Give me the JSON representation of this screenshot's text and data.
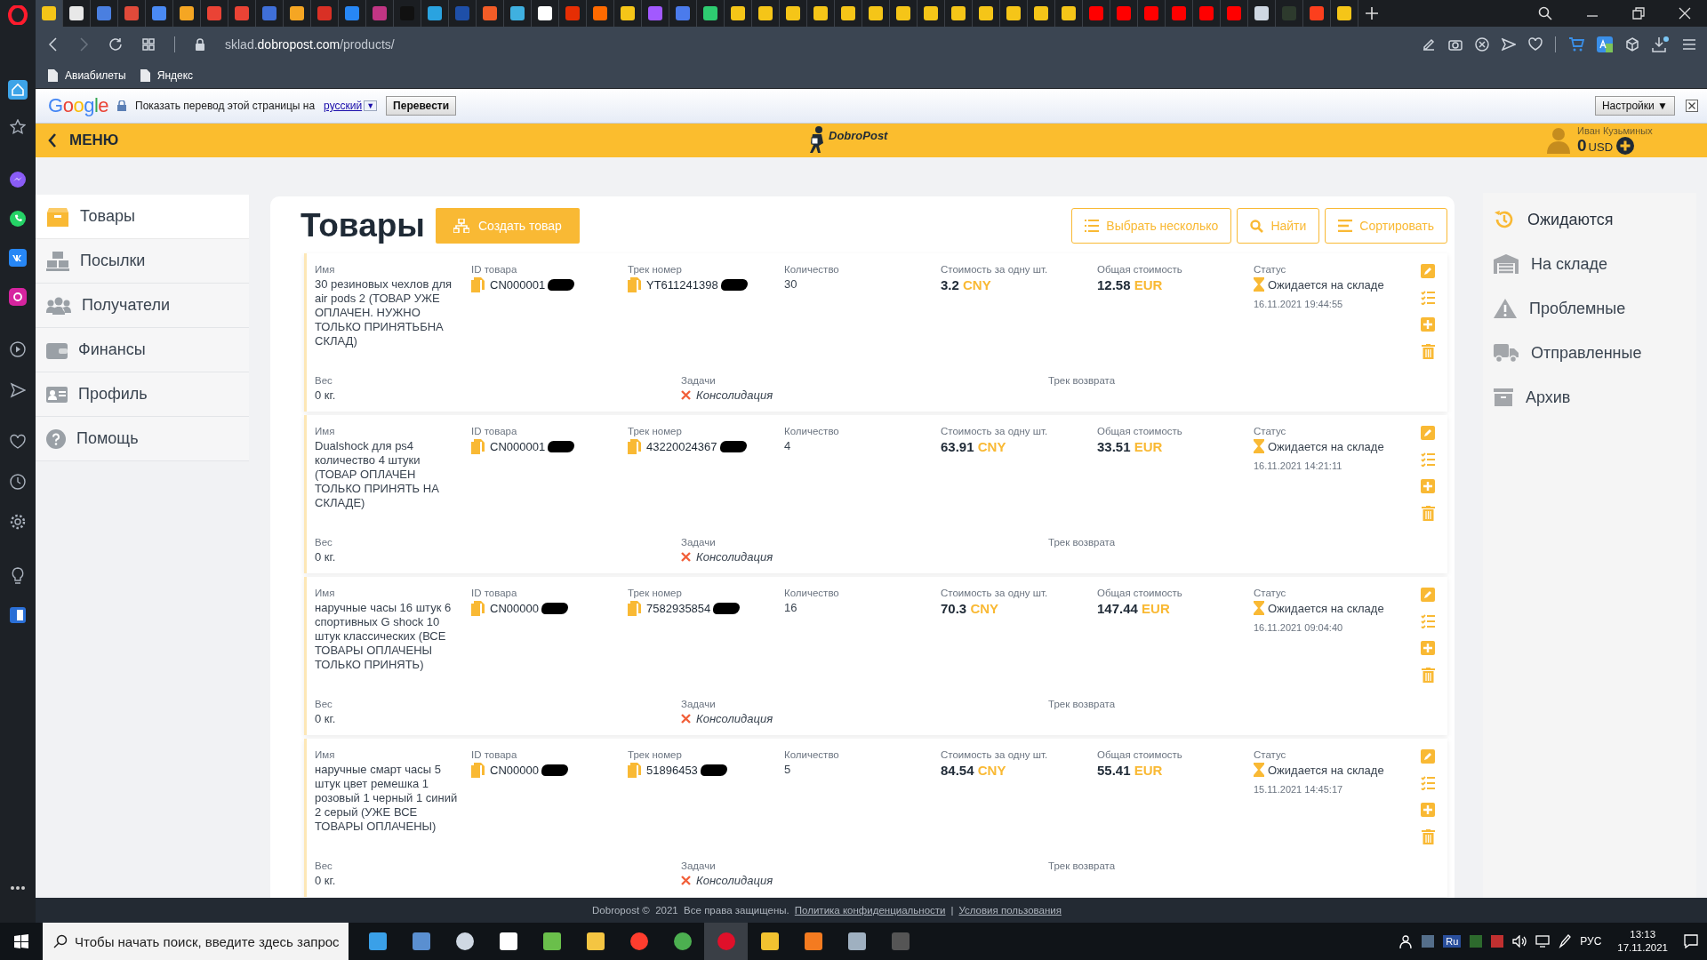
{
  "browser": {
    "tabs": [
      {
        "selected": true,
        "color": "#f5c518"
      },
      {
        "selected": false,
        "color": "#e8e8e8"
      },
      {
        "selected": false,
        "color": "#4a7fe0"
      },
      {
        "selected": false,
        "color": "#e04a3a"
      },
      {
        "selected": false,
        "color": "#4a8af4"
      },
      {
        "selected": false,
        "color": "#f5a623"
      },
      {
        "selected": false,
        "color": "#ea4335"
      },
      {
        "selected": false,
        "color": "#ea4335"
      },
      {
        "selected": false,
        "color": "#3f6fd8"
      },
      {
        "selected": false,
        "color": "#f5a623"
      },
      {
        "selected": false,
        "color": "#d93025"
      },
      {
        "selected": false,
        "color": "#2787f5"
      },
      {
        "selected": false,
        "color": "#c13584"
      },
      {
        "selected": false,
        "color": "#111111"
      },
      {
        "selected": false,
        "color": "#2aa3e0"
      },
      {
        "selected": false,
        "color": "#1e4fa8"
      },
      {
        "selected": false,
        "color": "#f25c27"
      },
      {
        "selected": false,
        "color": "#3fb0e0"
      },
      {
        "selected": false,
        "color": "#ffffff"
      },
      {
        "selected": false,
        "color": "#e62e04"
      },
      {
        "selected": false,
        "color": "#ff6a00"
      },
      {
        "selected": false,
        "color": "#f5c518"
      },
      {
        "selected": false,
        "color": "#a259ff"
      },
      {
        "selected": false,
        "color": "#4b7bec"
      },
      {
        "selected": false,
        "color": "#2ecc71"
      },
      {
        "selected": false,
        "color": "#f5c518"
      },
      {
        "selected": false,
        "color": "#f5c518"
      },
      {
        "selected": false,
        "color": "#f5c518"
      },
      {
        "selected": false,
        "color": "#f5c518"
      },
      {
        "selected": false,
        "color": "#f5c518"
      },
      {
        "selected": false,
        "color": "#f5c518"
      },
      {
        "selected": false,
        "color": "#f5c518"
      },
      {
        "selected": false,
        "color": "#f5c518"
      },
      {
        "selected": false,
        "color": "#f5c518"
      },
      {
        "selected": false,
        "color": "#f5c518"
      },
      {
        "selected": false,
        "color": "#f5c518"
      },
      {
        "selected": false,
        "color": "#f5c518"
      },
      {
        "selected": false,
        "color": "#f5c518"
      },
      {
        "selected": false,
        "color": "#ff0000"
      },
      {
        "selected": false,
        "color": "#ff0000"
      },
      {
        "selected": false,
        "color": "#ff0000"
      },
      {
        "selected": false,
        "color": "#ff0000"
      },
      {
        "selected": false,
        "color": "#ff0000"
      },
      {
        "selected": false,
        "color": "#ff0000"
      },
      {
        "selected": false,
        "color": "#cfd8e3"
      },
      {
        "selected": false,
        "color": "#2d3a2d"
      },
      {
        "selected": false,
        "color": "#fc3f1d"
      },
      {
        "selected": false,
        "color": "#f5c518"
      }
    ],
    "address": {
      "subdomain": "sklad.",
      "domain": "dobropost.com",
      "path": "/products/"
    },
    "bookmarks": [
      "Авиабилеты",
      "Яндекс"
    ]
  },
  "translate_bar": {
    "logo": "Google",
    "prompt": "Показать перевод этой страницы на",
    "language": "русский",
    "language_caret": "▼",
    "translate_button": "Перевести",
    "settings_button": "Настройки ▼"
  },
  "header": {
    "menu": "МЕНЮ",
    "logo": "DobroPost",
    "user_name": "Иван Кузьминых",
    "balance": "0",
    "balance_currency": "USD"
  },
  "nav": [
    {
      "label": "Товары",
      "selected": true
    },
    {
      "label": "Посылки",
      "selected": false
    },
    {
      "label": "Получатели",
      "selected": false
    },
    {
      "label": "Финансы",
      "selected": false
    },
    {
      "label": "Профиль",
      "selected": false
    },
    {
      "label": "Помощь",
      "selected": false
    }
  ],
  "page": {
    "title": "Товары",
    "create_button": "Создать товар",
    "actions": [
      "Выбрать несколько",
      "Найти",
      "Сортировать"
    ]
  },
  "products": [
    {
      "labels": {
        "name": "Имя",
        "id": "ID товара",
        "track": "Трек номер",
        "qty": "Количество",
        "unit_price": "Стоимость за одну шт.",
        "total": "Общая стоимость",
        "status": "Статус",
        "weight": "Вес",
        "tasks": "Задачи",
        "return_track": "Трек возврата"
      },
      "name": "30 резиновых чехлов для air pods 2 (ТОВАР УЖЕ ОПЛАЧЕН. НУЖНО ТОЛЬКО ПРИНЯТЬБНА СКЛАД)",
      "id": "CN000001",
      "track": "YT611241398",
      "qty": "30",
      "unit_price": "3.2",
      "unit_currency": "CNY",
      "total": "12.58",
      "total_currency": "EUR",
      "status": "Ожидается на складе",
      "date": "16.11.2021 19:44:55",
      "weight": "0 кг.",
      "tasks": [
        {
          "label": "Консолидация",
          "done": false
        }
      ]
    },
    {
      "labels": {
        "name": "Имя",
        "id": "ID товара",
        "track": "Трек номер",
        "qty": "Количество",
        "unit_price": "Стоимость за одну шт.",
        "total": "Общая стоимость",
        "status": "Статус",
        "weight": "Вес",
        "tasks": "Задачи",
        "return_track": "Трек возврата"
      },
      "name": "Dualshock для ps4 количество 4 штуки (ТОВАР ОПЛАЧЕН ТОЛЬКО ПРИНЯТЬ НА СКЛАДЕ)",
      "id": "CN000001",
      "track": "43220024367",
      "qty": "4",
      "unit_price": "63.91",
      "unit_currency": "CNY",
      "total": "33.51",
      "total_currency": "EUR",
      "status": "Ожидается на складе",
      "date": "16.11.2021 14:21:11",
      "weight": "0 кг.",
      "tasks": [
        {
          "label": "Консолидация",
          "done": false
        }
      ]
    },
    {
      "labels": {
        "name": "Имя",
        "id": "ID товара",
        "track": "Трек номер",
        "qty": "Количество",
        "unit_price": "Стоимость за одну шт.",
        "total": "Общая стоимость",
        "status": "Статус",
        "weight": "Вес",
        "tasks": "Задачи",
        "return_track": "Трек возврата"
      },
      "name": "наручные часы 16 штук 6 спортивных G shock 10 штук классических (ВСЕ ТОВАРЫ ОПЛАЧЕНЫ ТОЛЬКО ПРИНЯТЬ)",
      "id": "CN00000",
      "track": "7582935854",
      "qty": "16",
      "unit_price": "70.3",
      "unit_currency": "CNY",
      "total": "147.44",
      "total_currency": "EUR",
      "status": "Ожидается на складе",
      "date": "16.11.2021 09:04:40",
      "weight": "0 кг.",
      "tasks": [
        {
          "label": "Консолидация",
          "done": false
        }
      ]
    },
    {
      "labels": {
        "name": "Имя",
        "id": "ID товара",
        "track": "Трек номер",
        "qty": "Количество",
        "unit_price": "Стоимость за одну шт.",
        "total": "Общая стоимость",
        "status": "Статус",
        "weight": "Вес",
        "tasks": "Задачи",
        "return_track": "Трек возврата"
      },
      "name": "наручные смарт часы 5 штук цвет ремешка 1 розовый 1 черный 1 синий 2 серый (УЖЕ ВСЕ ТОВАРЫ ОПЛАЧЕНЫ)",
      "id": "CN00000",
      "track": "51896453",
      "qty": "5",
      "unit_price": "84.54",
      "unit_currency": "CNY",
      "total": "55.41",
      "total_currency": "EUR",
      "status": "Ожидается на складе",
      "date": "15.11.2021 14:45:17",
      "weight": "0 кг.",
      "tasks": [
        {
          "label": "Консолидация",
          "done": false
        }
      ]
    }
  ],
  "filters": [
    {
      "label": "Ожидаются",
      "selected": true
    },
    {
      "label": "На складе",
      "selected": false
    },
    {
      "label": "Проблемные",
      "selected": false
    },
    {
      "label": "Отправленные",
      "selected": false
    },
    {
      "label": "Архив",
      "selected": false
    }
  ],
  "footer": {
    "copyright": "Dobropost ©  2021  Все права защищены.",
    "links": [
      "Политика конфиденциальности",
      "Условия пользования"
    ],
    "separator": "|"
  },
  "taskbar": {
    "search": {
      "placeholder": "Чтобы начать поиск, введите здесь запрос"
    },
    "keyboard_indicator": "Ru",
    "input_language": "РУС",
    "time": "13:13",
    "date": "17.11.2021"
  }
}
